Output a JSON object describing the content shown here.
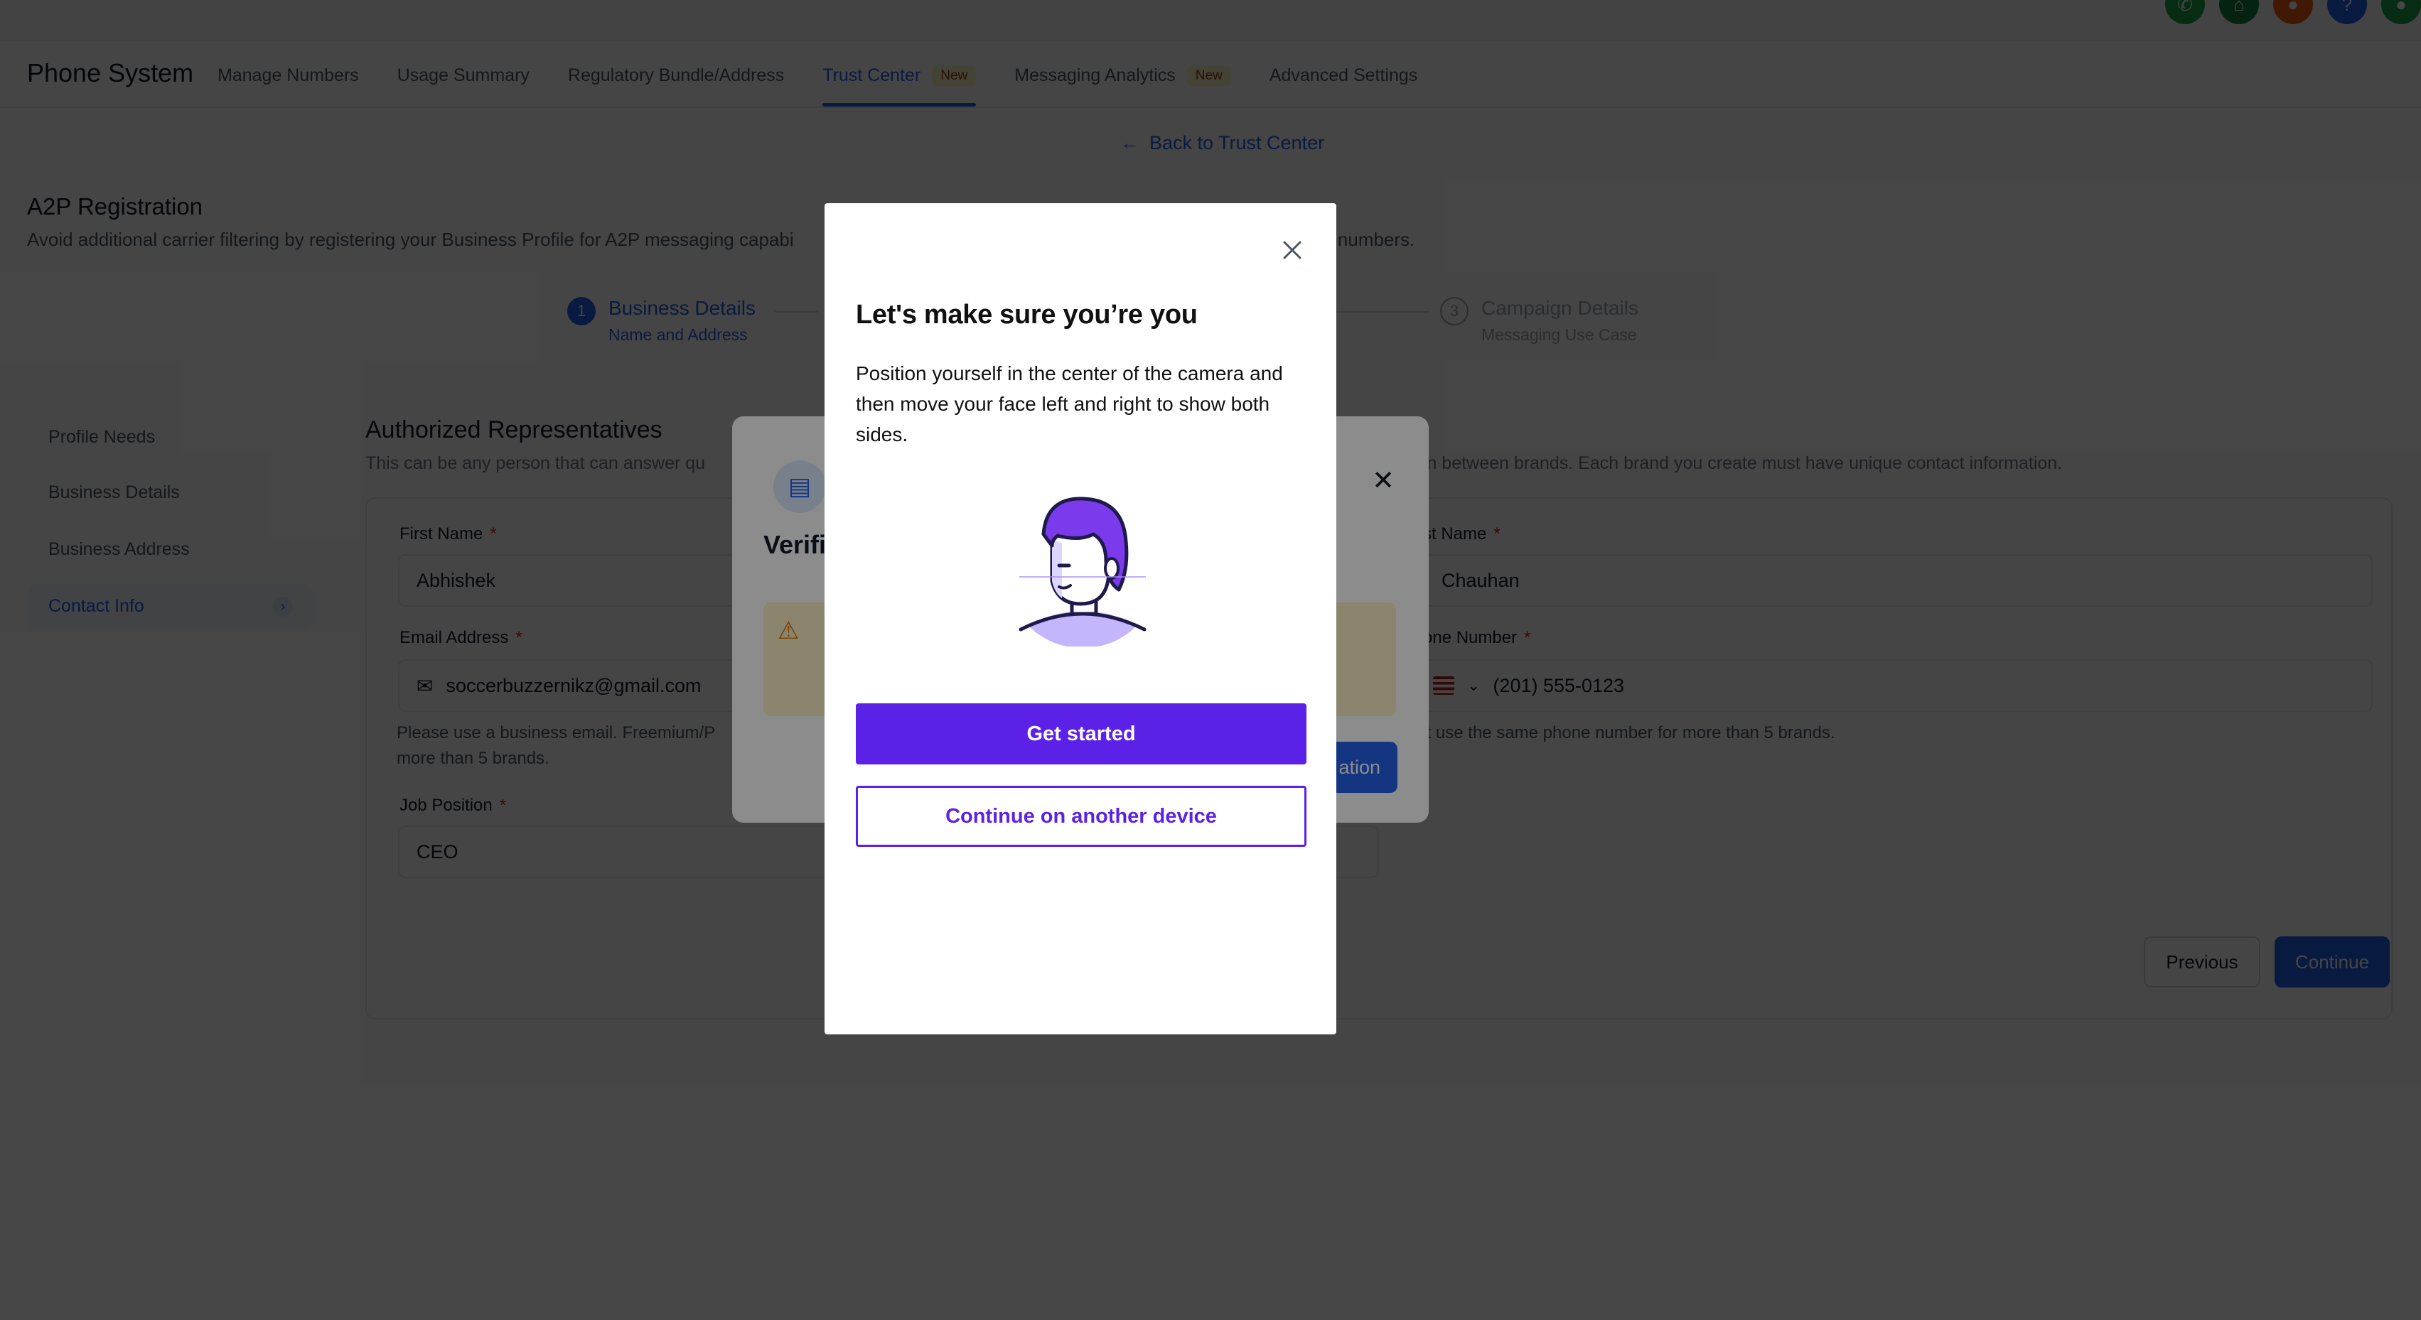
{
  "app": {
    "title": "Phone System",
    "tabs": [
      {
        "label": "Manage Numbers"
      },
      {
        "label": "Usage Summary"
      },
      {
        "label": "Regulatory Bundle/Address"
      },
      {
        "label": "Trust Center",
        "badge": "New",
        "active": true
      },
      {
        "label": "Messaging Analytics",
        "badge": "New"
      },
      {
        "label": "Advanced Settings"
      }
    ],
    "top_icons": [
      {
        "icon": "phone-icon",
        "color": "#16a34a"
      },
      {
        "icon": "store-icon",
        "color": "#15803d"
      },
      {
        "icon": "bell-icon",
        "color": "#ea580c"
      },
      {
        "icon": "help-icon",
        "color": "#2563eb"
      },
      {
        "icon": "avatar-icon",
        "color": "#16a34a"
      }
    ]
  },
  "page": {
    "back_link": "Back to Trust Center",
    "heading": "A2P Registration",
    "description_left": "Avoid additional carrier filtering by registering your Business Profile for A2P messaging capabi",
    "description_right": "g code numbers."
  },
  "stepper": {
    "step1": {
      "number": "1",
      "title": "Business Details",
      "subtitle": "Name and Address"
    },
    "step3": {
      "number": "3",
      "title": "Campaign Details",
      "subtitle": "Messaging Use Case"
    }
  },
  "sidebar": {
    "items": [
      {
        "label": "Profile Needs"
      },
      {
        "label": "Business Details"
      },
      {
        "label": "Business Address"
      },
      {
        "label": "Contact Info",
        "active": true
      }
    ]
  },
  "form": {
    "title": "Authorized Representatives",
    "desc_left": "This can be any person that can answer qu",
    "desc_right": "rmation between brands. Each brand you create must have unique contact information.",
    "first_name_label": "First Name",
    "first_name_value": "Abhishek",
    "last_name_label": "st Name",
    "last_name_value": "Chauhan",
    "email_label": "Email Address",
    "email_value": "soccerbuzzernikz@gmail.com",
    "email_help_1": "Please use a business email. Freemium/P",
    "email_help_2": "more than 5 brands.",
    "phone_label": "one Number",
    "phone_value": "(201) 555-0123",
    "phone_help": "'t use the same phone number for more than 5 brands.",
    "job_label": "Job Position",
    "job_value": "CEO",
    "required_mark": "*",
    "previous_label": "Previous",
    "continue_label": "Continue"
  },
  "verify_modal": {
    "title": "Verific",
    "button_label": "ation"
  },
  "identity_modal": {
    "title": "Let's make sure you’re you",
    "body": "Position yourself in the center of the camera and then move your face left and right to show both sides.",
    "primary_label": "Get started",
    "secondary_label": "Continue on another device",
    "accent_color": "#5b21e6"
  }
}
